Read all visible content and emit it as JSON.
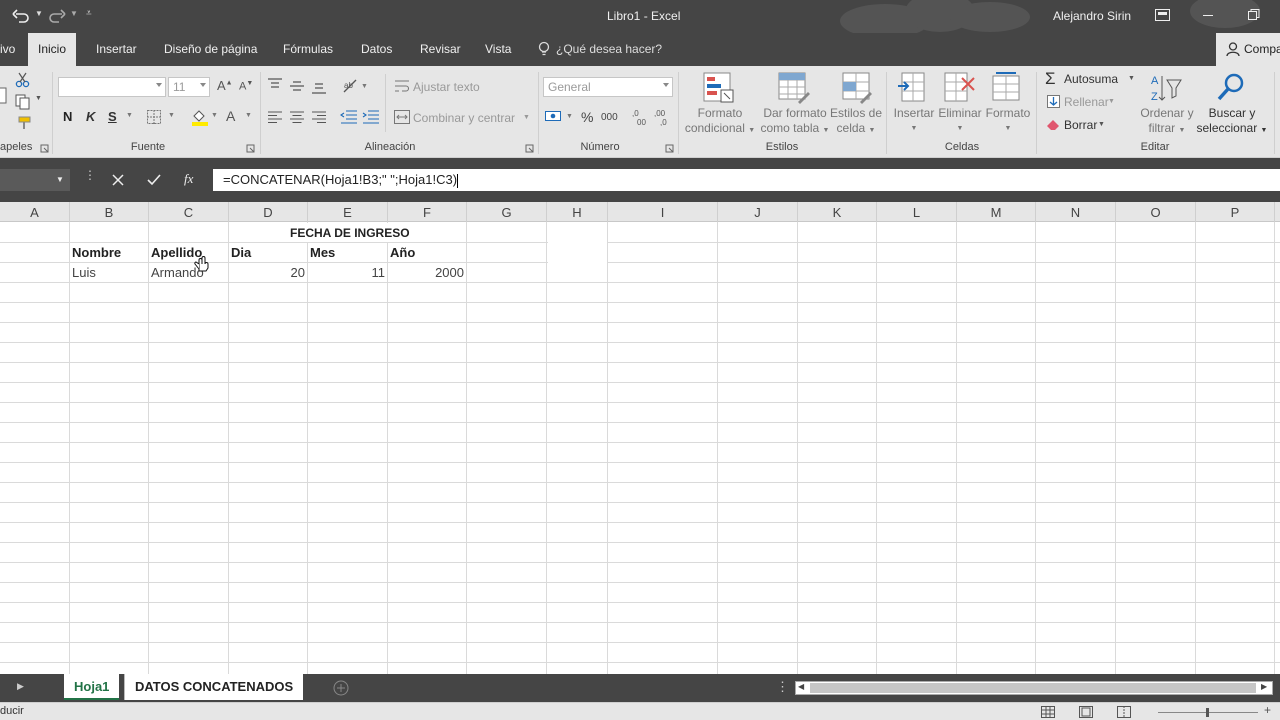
{
  "titlebar": {
    "title": "Libro1 - Excel",
    "user": "Alejandro Sirin"
  },
  "tabs": {
    "archivo": "ivo",
    "items": [
      "Inicio",
      "Insertar",
      "Diseño de página",
      "Fórmulas",
      "Datos",
      "Revisar",
      "Vista"
    ],
    "search": "¿Qué desea hacer?",
    "share": "Compa"
  },
  "ribbon": {
    "clipboard_label": "apeles",
    "font": {
      "font_name": "",
      "font_size": "11",
      "bold": "N",
      "italic": "K",
      "underline": "S",
      "label": "Fuente"
    },
    "alignment": {
      "wrap_text": "Ajustar texto",
      "merge_center": "Combinar y centrar",
      "label": "Alineación"
    },
    "number": {
      "format": "General",
      "percent": "%",
      "thousands": "000",
      "label": "Número"
    },
    "styles": {
      "conditional_1": "Formato",
      "conditional_2": "condicional",
      "table_1": "Dar formato",
      "table_2": "como tabla",
      "cell_1": "Estilos de",
      "cell_2": "celda",
      "label": "Estilos"
    },
    "cells": {
      "insert": "Insertar",
      "delete": "Eliminar",
      "format": "Formato",
      "label": "Celdas"
    },
    "editing": {
      "autosum": "Autosuma",
      "fill": "Rellenar",
      "clear": "Borrar",
      "sort_1": "Ordenar y",
      "sort_2": "filtrar",
      "find_1": "Buscar y",
      "find_2": "seleccionar",
      "label": "Editar"
    }
  },
  "formula_bar": {
    "fx": "fx",
    "formula": "=CONCATENAR(Hoja1!B3;\" \";Hoja1!C3)"
  },
  "grid": {
    "columns": [
      "A",
      "B",
      "C",
      "D",
      "E",
      "F",
      "G",
      "H",
      "I",
      "J",
      "K",
      "L",
      "M",
      "N",
      "O",
      "P"
    ],
    "title": "FECHA DE INGRESO",
    "headers": {
      "nombre": "Nombre",
      "apellido": "Apellido",
      "dia": "Dia",
      "mes": "Mes",
      "anio": "Año"
    },
    "row": {
      "nombre": "Luis",
      "apellido": "Armando",
      "dia": "20",
      "mes": "11",
      "anio": "2000"
    }
  },
  "sheets": [
    "Hoja1",
    "DATOS CONCATENADOS"
  ],
  "status": {
    "mode": "ducir"
  },
  "colors": {
    "dark": "#454545",
    "ribbon": "#e6e6e6",
    "accent_green": "#217346"
  }
}
